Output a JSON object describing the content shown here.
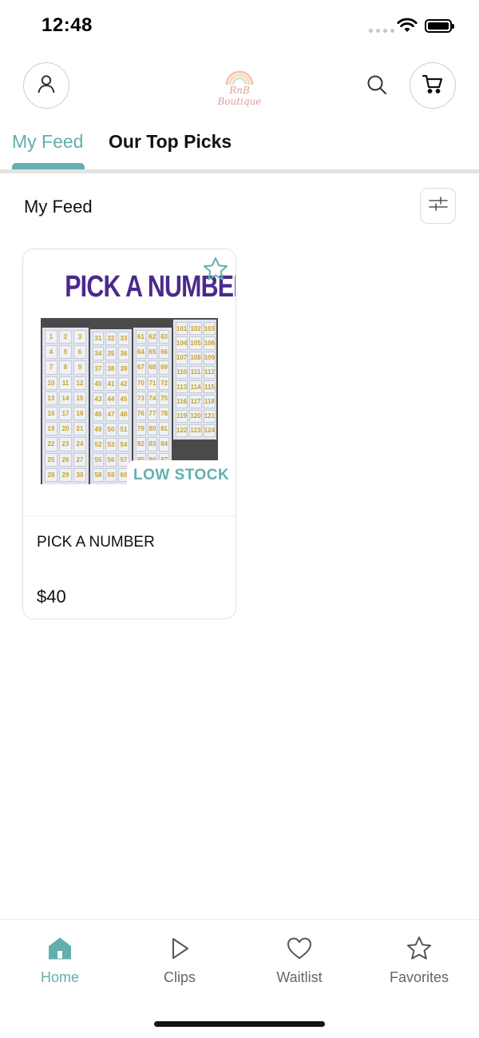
{
  "status_bar": {
    "time": "12:48"
  },
  "header": {
    "logo_text": "RnB Boutique",
    "account_icon": "person-icon",
    "search_icon": "search-icon",
    "cart_icon": "cart-icon"
  },
  "tabs": [
    {
      "label": "My Feed",
      "active": true
    },
    {
      "label": "Our Top Picks",
      "active": false
    }
  ],
  "section": {
    "title": "My Feed",
    "filter_icon": "sliders-icon"
  },
  "products": [
    {
      "image_title": "PICK A NUMBER",
      "badge": "LOW STOCK",
      "name": "PICK A NUMBER",
      "price": "$40",
      "favorite_icon": "star-icon"
    }
  ],
  "bottom_nav": [
    {
      "label": "Home",
      "icon": "home-icon",
      "active": true
    },
    {
      "label": "Clips",
      "icon": "play-icon",
      "active": false
    },
    {
      "label": "Waitlist",
      "icon": "heart-icon",
      "active": false
    },
    {
      "label": "Favorites",
      "icon": "star-icon",
      "active": false
    }
  ],
  "colors": {
    "accent": "#64aeae",
    "image_title": "#4b2a8c",
    "border": "#e1e1e1"
  }
}
